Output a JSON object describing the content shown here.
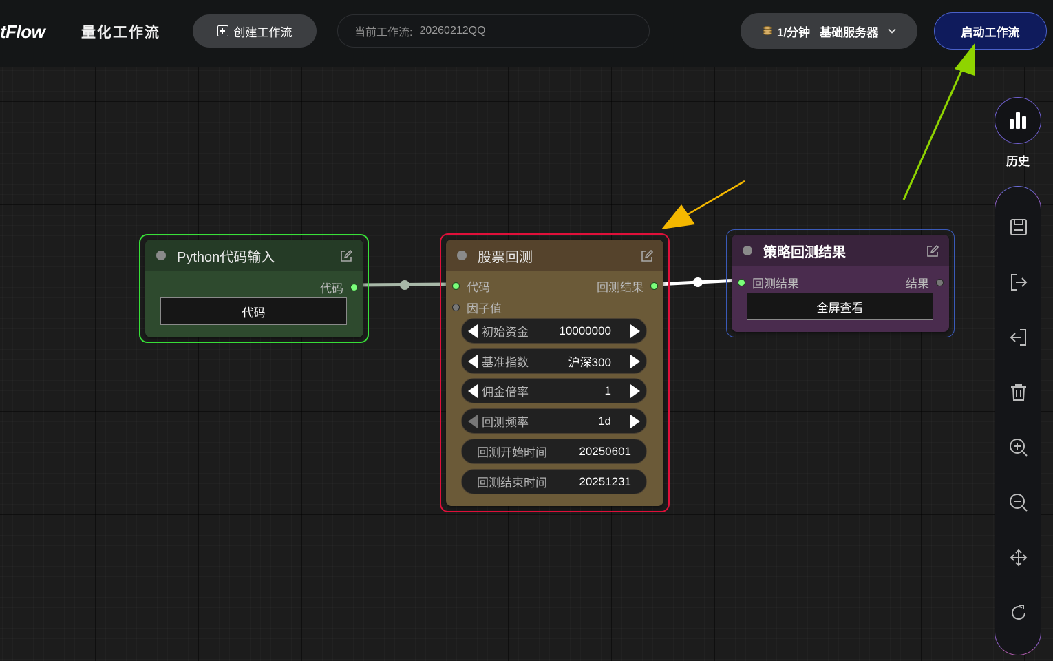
{
  "header": {
    "logo": "tFlow",
    "app_title": "量化工作流",
    "create_button": "创建工作流",
    "workflow_label": "当前工作流:",
    "workflow_name": "20260212QQ",
    "server_rate": "1/分钟",
    "server_tier": "基础服务器",
    "start_button": "启动工作流"
  },
  "sidebar": {
    "history_label": "历史",
    "tools": [
      "save-icon",
      "export-icon",
      "import-icon",
      "trash-icon",
      "zoom-in-icon",
      "zoom-out-icon",
      "move-icon",
      "refresh-icon"
    ]
  },
  "nodes": {
    "python_input": {
      "title": "Python代码输入",
      "output_label": "代码",
      "button": "代码",
      "color": "#2e4a2e",
      "outline": "#38e038"
    },
    "backtest": {
      "title": "股票回测",
      "inputs": [
        "代码",
        "因子值"
      ],
      "output_label": "回测结果",
      "color": "#6b5a38",
      "outline": "#e0103a",
      "widgets": [
        {
          "label": "初始资金",
          "value": "10000000"
        },
        {
          "label": "基准指数",
          "value": "沪深300"
        },
        {
          "label": "佣金倍率",
          "value": "1"
        },
        {
          "label": "回测频率",
          "value": "1d"
        },
        {
          "label": "回测开始时间",
          "value": "20250601"
        },
        {
          "label": "回测结束时间",
          "value": "20251231"
        }
      ]
    },
    "result": {
      "title": "策略回测结果",
      "input_label": "回测结果",
      "output_label": "结果",
      "button": "全屏查看",
      "color": "#4a2c4e",
      "outline": "#3a5ab8"
    }
  },
  "annotations": {
    "arrow_colors": [
      "#f5b800",
      "#8fd400"
    ]
  }
}
